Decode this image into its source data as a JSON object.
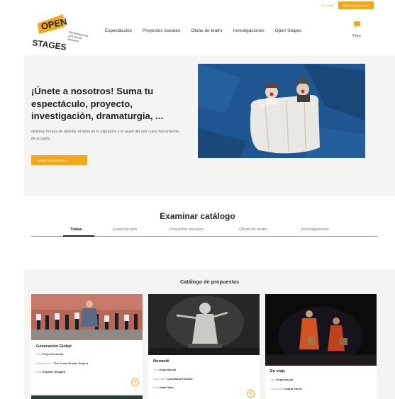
{
  "topbar": {
    "account_label": "Mi cuenta",
    "add_label": "Añade tu propuesta +"
  },
  "logo": {
    "word_top": "OPEN",
    "word_bottom": "STAGES",
    "tagline": [
      "Performing Arts",
      "and Social",
      "Inclusion"
    ]
  },
  "nav": {
    "items": [
      "Espectáculos",
      "Proyectos sociales",
      "Obras de teatro",
      "Investigaciones",
      "Open Stages"
    ],
    "foro_label": "Foro"
  },
  "hero": {
    "title": "¡Únete a nosotros! Suma tu espectáculo, proyecto, investigación, dramaturgia, ...",
    "description": "distintas formas de abordar el tema de la migración y el papel del arte como herramienta de acogida.",
    "cta_label": "Añade tu propuesta +"
  },
  "catalog": {
    "heading": "Examinar catálogo",
    "tabs": [
      "Todas",
      "Espectáculos",
      "Proyectos sociales",
      "Obras de teatro",
      "Investigaciones"
    ],
    "active_tab": "Todas"
  },
  "proposals": {
    "title": "Catálogo de propuestas",
    "cards": [
      {
        "name": "Generación Global",
        "lines": [
          {
            "label": "Tipo",
            "value": "Proyecto social"
          },
          {
            "label": "Organización",
            "value": "The Cross Border Project"
          },
          {
            "label": "País",
            "value": "España | España"
          }
        ]
      },
      {
        "name": "Nonnetti",
        "lines": [
          {
            "label": "Tipo",
            "value": "Espectáculo"
          },
          {
            "label": "Compañía",
            "value": "Coltellaria Einstein"
          },
          {
            "label": "País",
            "value": "Italia Italia"
          }
        ]
      },
      {
        "name": "En viaje",
        "lines": [
          {
            "label": "Tipo",
            "value": "Espectáculo"
          },
          {
            "label": "Compañía",
            "value": "Cuarta Pared"
          }
        ]
      }
    ]
  },
  "colors": {
    "accent": "#f2a81c",
    "section_bg": "#f4f4f2",
    "text_dark": "#222222"
  }
}
